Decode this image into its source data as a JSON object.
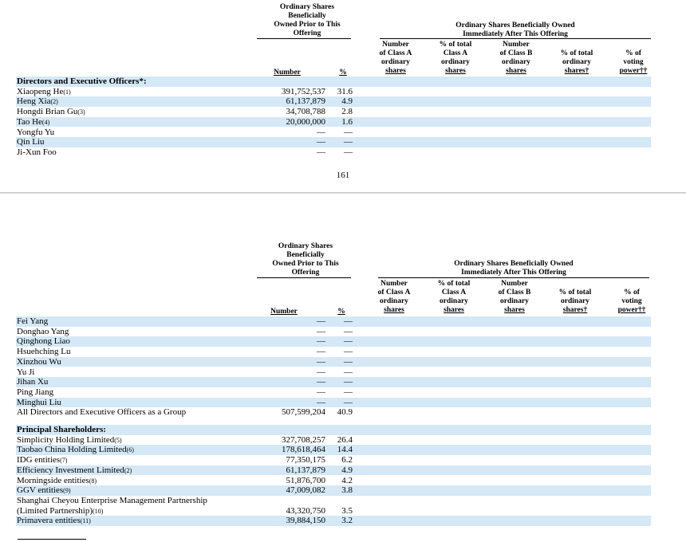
{
  "header": {
    "prior_title": [
      "Ordinary Shares",
      "Beneficially",
      "Owned Prior to This",
      "Offering"
    ],
    "after_title": [
      "Ordinary Shares Beneficially Owned",
      "Immediately After This Offering"
    ],
    "col_number": "Number",
    "col_pct": "%",
    "col_num_class_a": [
      "Number",
      "of Class A",
      "ordinary",
      "shares"
    ],
    "col_pct_class_a": [
      "% of total",
      "Class A",
      "ordinary",
      "shares"
    ],
    "col_num_class_b": [
      "Number",
      "of Class B",
      "ordinary",
      "shares"
    ],
    "col_pct_total": [
      "% of total",
      "ordinary",
      "shares†"
    ],
    "col_voting": [
      "% of",
      "voting",
      "power††"
    ]
  },
  "page1": {
    "rows": [
      {
        "name": "Directors and Executive Officers*:",
        "number": "",
        "pct": "",
        "section": true,
        "shade": true
      },
      {
        "name": "Xiaopeng He",
        "note": "(1)",
        "number": "391,752,537",
        "pct": "31.6",
        "shade": false
      },
      {
        "name": "Heng Xia",
        "note": "(2)",
        "number": "61,137,879",
        "pct": "4.9",
        "shade": true
      },
      {
        "name": "Hongdi Brian Gu",
        "note": "(3)",
        "number": "34,708,788",
        "pct": "2.8",
        "shade": false
      },
      {
        "name": "Tao He",
        "note": "(4)",
        "number": "20,000,000",
        "pct": "1.6",
        "shade": true
      },
      {
        "name": "Yongfu Yu",
        "note": "",
        "number": "—",
        "pct": "—",
        "shade": false
      },
      {
        "name": "Qin Liu",
        "note": "",
        "number": "—",
        "pct": "—",
        "shade": true
      },
      {
        "name": "Ji-Xun Foo",
        "note": "",
        "number": "—",
        "pct": "—",
        "shade": false
      }
    ],
    "page_number": "161"
  },
  "page2": {
    "rows": [
      {
        "name": "Fei Yang",
        "note": "",
        "number": "—",
        "pct": "—",
        "shade": true
      },
      {
        "name": "Donghao Yang",
        "note": "",
        "number": "—",
        "pct": "—",
        "shade": false
      },
      {
        "name": "Qinghong Liao",
        "note": "",
        "number": "—",
        "pct": "—",
        "shade": true
      },
      {
        "name": "Hsuehching Lu",
        "note": "",
        "number": "—",
        "pct": "—",
        "shade": false
      },
      {
        "name": "Xinzhou Wu",
        "note": "",
        "number": "—",
        "pct": "—",
        "shade": true
      },
      {
        "name": "Yu Ji",
        "note": "",
        "number": "—",
        "pct": "—",
        "shade": false
      },
      {
        "name": "Jihan Xu",
        "note": "",
        "number": "—",
        "pct": "—",
        "shade": true
      },
      {
        "name": "Ping Jiang",
        "note": "",
        "number": "—",
        "pct": "—",
        "shade": false
      },
      {
        "name": "Minghui Liu",
        "note": "",
        "number": "—",
        "pct": "—",
        "shade": true
      },
      {
        "name": "All Directors and Executive Officers as a Group",
        "note": "",
        "number": "507,599,204",
        "pct": "40.9",
        "shade": false
      },
      {
        "name": "Principal Shareholders:",
        "note": "",
        "number": "",
        "pct": "",
        "section": true,
        "shade": true
      },
      {
        "name": "Simplicity Holding Limited",
        "note": "(5)",
        "number": "327,708,257",
        "pct": "26.4",
        "shade": false
      },
      {
        "name": "Taobao China Holding Limited",
        "note": "(6)",
        "number": "178,618,464",
        "pct": "14.4",
        "shade": true
      },
      {
        "name": "IDG entities",
        "note": "(7)",
        "number": "77,350,175",
        "pct": "6.2",
        "shade": false
      },
      {
        "name": "Efficiency Investment Limited",
        "note": "(2)",
        "number": "61,137,879",
        "pct": "4.9",
        "shade": true
      },
      {
        "name": "Morningside entities",
        "note": "(8)",
        "number": "51,876,700",
        "pct": "4.2",
        "shade": false
      },
      {
        "name": "GGV entities",
        "note": "(9)",
        "number": "47,009,082",
        "pct": "3.8",
        "shade": true
      },
      {
        "name": "Shanghai Cheyou Enterprise Management Partnership",
        "note": "",
        "number": "",
        "pct": "",
        "shade": false
      },
      {
        "name": "   (Limited Partnership)",
        "note": "(10)",
        "number": "43,320,750",
        "pct": "3.5",
        "shade": false
      },
      {
        "name": "Primavera entities",
        "note": "(11)",
        "number": "39,884,150",
        "pct": "3.2",
        "shade": true
      }
    ]
  }
}
